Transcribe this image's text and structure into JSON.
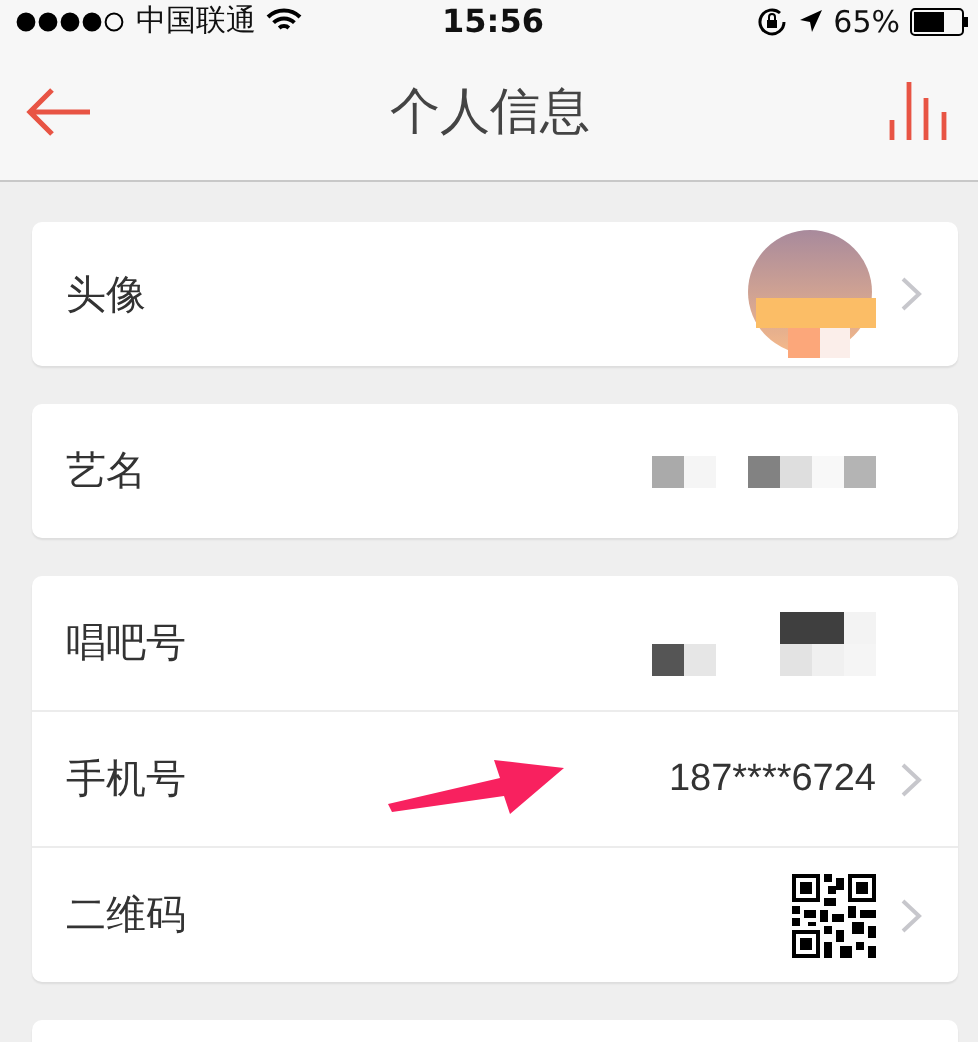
{
  "status_bar": {
    "carrier": "中国联通",
    "time": "15:56",
    "battery": "65%"
  },
  "nav_bar": {
    "title": "个人信息"
  },
  "sections": [
    {
      "rows": [
        {
          "label": "头像",
          "kind": "avatar",
          "chevron": true
        }
      ]
    },
    {
      "rows": [
        {
          "label": "艺名",
          "kind": "mosaic",
          "chevron": false
        }
      ]
    },
    {
      "rows": [
        {
          "label": "唱吧号",
          "kind": "mosaic",
          "chevron": false
        },
        {
          "label": "手机号",
          "kind": "text",
          "value": "187****6724",
          "chevron": true
        },
        {
          "label": "二维码",
          "kind": "qr",
          "chevron": true
        }
      ]
    }
  ]
}
